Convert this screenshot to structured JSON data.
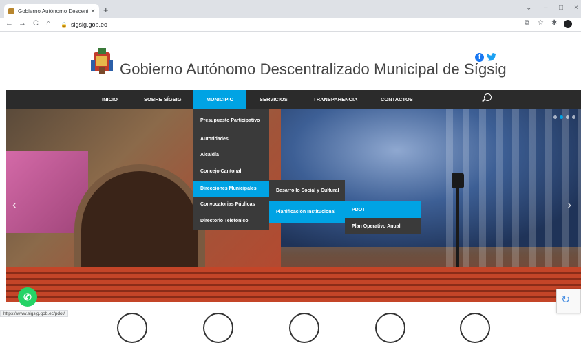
{
  "browser": {
    "tab_title": "Gobierno Autónomo Descentrali...",
    "tab_close": "×",
    "new_tab": "+",
    "address": "sigsig.gob.ec",
    "status_url": "https://www.sigsig.gob.ec/pdot/",
    "controls": {
      "minimize": "–",
      "maximize": "□",
      "close": "×",
      "chevron": "⌄"
    },
    "nav": {
      "back": "←",
      "forward": "→",
      "reload": "C",
      "home": "⌂"
    }
  },
  "header": {
    "title": "Gobierno Autónomo Descentralizado Municipal de Sígsig",
    "social": {
      "facebook": "f",
      "twitter": "🐦"
    }
  },
  "nav": {
    "items": [
      {
        "label": "INICIO"
      },
      {
        "label": "SOBRE SÍGSIG"
      },
      {
        "label": "MUNICIPIO"
      },
      {
        "label": "SERVICIOS"
      },
      {
        "label": "TRANSPARENCIA"
      },
      {
        "label": "CONTACTOS"
      }
    ],
    "active": "MUNICIPIO"
  },
  "dropdown": {
    "items": [
      {
        "label": "Presupuesto Participativo"
      },
      {
        "label": "Autoridades"
      },
      {
        "label": "Alcaldía"
      },
      {
        "label": "Concejo Cantonal"
      },
      {
        "label": "Direcciones Municipales"
      },
      {
        "label": "Convocatorias Públicas"
      },
      {
        "label": "Directorio Telefónico"
      }
    ],
    "submenu": [
      {
        "label": "Desarrollo Social y Cultural"
      },
      {
        "label": "Planificación Institucional"
      }
    ],
    "submenu2": [
      {
        "label": "PDOT"
      },
      {
        "label": "Plan Operativo Anual"
      }
    ]
  },
  "hero": {
    "prev": "‹",
    "next": "›"
  },
  "widgets": {
    "whatsapp": "✆",
    "recaptcha": "↻"
  },
  "colors": {
    "accent": "#00a3e4",
    "nav_bg": "#2b2b2b",
    "menu_bg": "#3a3a3a"
  }
}
